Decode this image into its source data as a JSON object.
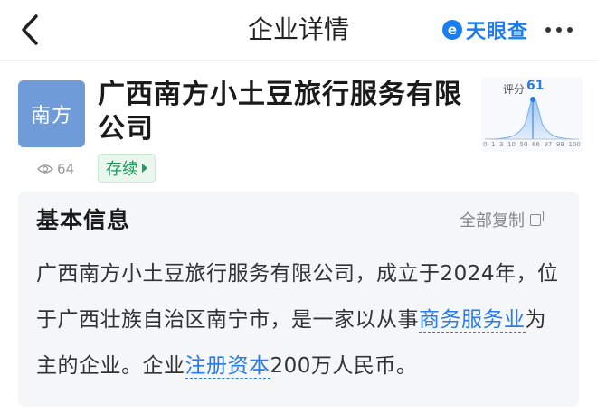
{
  "nav": {
    "title": "企业详情",
    "brand_logo_glyph": "e",
    "brand_text": "天眼查",
    "back_icon": "chevron-left-icon",
    "more_icon": "more-dots-icon"
  },
  "company": {
    "logo_text": "南方",
    "name": "广西南方小土豆旅行服务有限公司",
    "views": "64",
    "status": "存续"
  },
  "score": {
    "label": "评分",
    "value": "61",
    "ticks": [
      "0",
      "1",
      "3",
      "10",
      "50",
      "66",
      "97",
      "99",
      "100"
    ]
  },
  "info": {
    "title": "基本信息",
    "copy_label": "全部复制",
    "text_1": "广西南方小土豆旅行服务有限公司，成立于2024年，位于广西壮族自治区南宁市，是一家以从事",
    "link_industry": "商务服务业",
    "text_2": "为主的企业。企业",
    "link_capital": "注册资本",
    "text_3": "200万人民币。"
  },
  "colors": {
    "accent": "#2a7be5",
    "status_green": "#1d9b5a",
    "logo_bg": "#6f9cd8",
    "card_bg": "#f5f6f8"
  }
}
